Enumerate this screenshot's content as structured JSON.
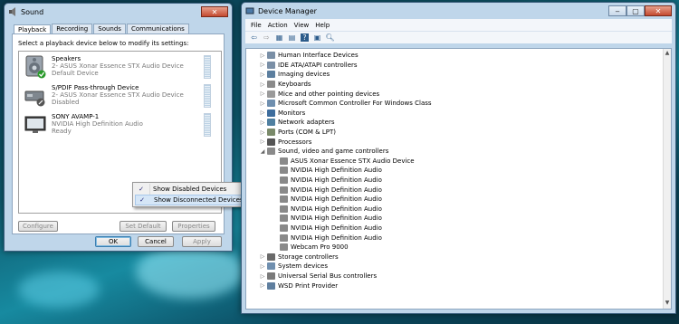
{
  "sound": {
    "title": "Sound",
    "tabs": [
      "Playback",
      "Recording",
      "Sounds",
      "Communications"
    ],
    "instruction": "Select a playback device below to modify its settings:",
    "devices": [
      {
        "name": "Speakers",
        "line1": "2- ASUS Xonar Essence STX Audio Device",
        "line2": "Default Device",
        "icon": "speaker-icon"
      },
      {
        "name": "S/PDIF Pass-through Device",
        "line1": "2- ASUS Xonar Essence STX Audio Device",
        "line2": "Disabled",
        "icon": "spdif-device-icon"
      },
      {
        "name": "SONY AVAMP-1",
        "line1": "NVIDIA High Definition Audio",
        "line2": "Ready",
        "icon": "monitor-icon"
      }
    ],
    "buttons": {
      "configure": "Configure",
      "set_default": "Set Default",
      "properties": "Properties",
      "ok": "OK",
      "cancel": "Cancel",
      "apply": "Apply"
    },
    "context_menu": [
      "Show Disabled Devices",
      "Show Disconnected Devices"
    ]
  },
  "devmgr": {
    "title": "Device Manager",
    "menu": [
      "File",
      "Action",
      "View",
      "Help"
    ],
    "tree": [
      {
        "label": "Human Interface Devices",
        "level": 0,
        "exp": "▷",
        "color": "#7a8fa6"
      },
      {
        "label": "IDE ATA/ATAPI controllers",
        "level": 0,
        "exp": "▷",
        "color": "#7a8fa6"
      },
      {
        "label": "Imaging devices",
        "level": 0,
        "exp": "▷",
        "color": "#5c7f9f"
      },
      {
        "label": "Keyboards",
        "level": 0,
        "exp": "▷",
        "color": "#8a8a8a"
      },
      {
        "label": "Mice and other pointing devices",
        "level": 0,
        "exp": "▷",
        "color": "#9a9a9a"
      },
      {
        "label": "Microsoft Common Controller For Windows Class",
        "level": 0,
        "exp": "▷",
        "color": "#6f8faf"
      },
      {
        "label": "Monitors",
        "level": 0,
        "exp": "▷",
        "color": "#3d6d9d"
      },
      {
        "label": "Network adapters",
        "level": 0,
        "exp": "▷",
        "color": "#4f7fa0"
      },
      {
        "label": "Ports (COM & LPT)",
        "level": 0,
        "exp": "▷",
        "color": "#7a8a6a"
      },
      {
        "label": "Processors",
        "level": 0,
        "exp": "▷",
        "color": "#555555"
      },
      {
        "label": "Sound, video and game controllers",
        "level": 0,
        "exp": "◢",
        "color": "#8a8a8a"
      },
      {
        "label": "ASUS Xonar Essence STX Audio Device",
        "level": 1,
        "exp": "",
        "color": "#8a8a8a"
      },
      {
        "label": "NVIDIA High Definition Audio",
        "level": 1,
        "exp": "",
        "color": "#8a8a8a"
      },
      {
        "label": "NVIDIA High Definition Audio",
        "level": 1,
        "exp": "",
        "color": "#8a8a8a"
      },
      {
        "label": "NVIDIA High Definition Audio",
        "level": 1,
        "exp": "",
        "color": "#8a8a8a"
      },
      {
        "label": "NVIDIA High Definition Audio",
        "level": 1,
        "exp": "",
        "color": "#8a8a8a"
      },
      {
        "label": "NVIDIA High Definition Audio",
        "level": 1,
        "exp": "",
        "color": "#8a8a8a"
      },
      {
        "label": "NVIDIA High Definition Audio",
        "level": 1,
        "exp": "",
        "color": "#8a8a8a"
      },
      {
        "label": "NVIDIA High Definition Audio",
        "level": 1,
        "exp": "",
        "color": "#8a8a8a"
      },
      {
        "label": "NVIDIA High Definition Audio",
        "level": 1,
        "exp": "",
        "color": "#8a8a8a"
      },
      {
        "label": "Webcam Pro 9000",
        "level": 1,
        "exp": "",
        "color": "#8a8a8a"
      },
      {
        "label": "Storage controllers",
        "level": 0,
        "exp": "▷",
        "color": "#6a6a6a"
      },
      {
        "label": "System devices",
        "level": 0,
        "exp": "▷",
        "color": "#6f8faf"
      },
      {
        "label": "Universal Serial Bus controllers",
        "level": 0,
        "exp": "▷",
        "color": "#7a7a7a"
      },
      {
        "label": "WSD Print Provider",
        "level": 0,
        "exp": "▷",
        "color": "#5f7f9f"
      }
    ]
  }
}
